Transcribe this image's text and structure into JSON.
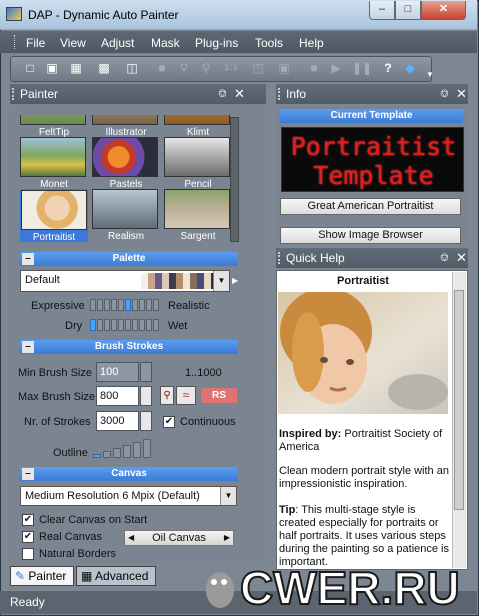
{
  "window": {
    "title": "DAP - Dynamic Auto Painter",
    "min": "–",
    "max": "□",
    "close": "✕"
  },
  "menu": [
    "File",
    "View",
    "Adjust",
    "Mask",
    "Plug-ins",
    "Tools",
    "Help"
  ],
  "toolbar": {
    "zoom_label": "1:1",
    "help_glyph": "?"
  },
  "painter": {
    "title": "Painter",
    "styles_top": [
      "FeltTip",
      "Illustrator",
      "Klimt"
    ],
    "styles_mid": [
      "Monet",
      "Pastels",
      "Pencil"
    ],
    "styles_bot": [
      "Portraitist",
      "Realism",
      "Sargent"
    ],
    "selected": "Portraitist",
    "palette": {
      "header": "Palette",
      "toggle": "–",
      "value": "Default",
      "swatches": [
        "#f4f0e8",
        "#c7a58a",
        "#6a5a8c",
        "#d9cbb6",
        "#3e3a52",
        "#b38e6b",
        "#efe6d2",
        "#8a6d5a",
        "#4b4b7a",
        "#e8d9c2",
        "#2f2a3c",
        "#c9b79d"
      ]
    },
    "expressive_label": "Expressive",
    "realistic_label": "Realistic",
    "expressive_level": 0.55,
    "dry_label": "Dry",
    "wet_label": "Wet",
    "dry_level": 0.0,
    "brush": {
      "header": "Brush Strokes",
      "toggle": "–",
      "min_label": "Min Brush Size",
      "min_value": "100",
      "range": "1..1000",
      "max_label": "Max Brush Size",
      "max_value": "800",
      "rs": "RS",
      "strokes_label": "Nr. of Strokes",
      "strokes_value": "3000",
      "continuous_label": "Continuous",
      "outline_label": "Outline"
    },
    "canvas": {
      "header": "Canvas",
      "toggle": "–",
      "resolution": "Medium Resolution 6 Mpix (Default)",
      "clear_label": "Clear Canvas on Start",
      "real_label": "Real Canvas",
      "canvas_type": "Oil Canvas",
      "borders_label": "Natural Borders"
    },
    "tabs": [
      "Painter",
      "Advanced"
    ]
  },
  "info": {
    "title": "Info",
    "current_template_label": "Current Template",
    "led_line1": "Portraitist",
    "led_line2": "Template",
    "artist_button": "Great American Portraitist",
    "browser_button": "Show Image Browser"
  },
  "help": {
    "title": "Quick Help",
    "heading": "Portraitist",
    "inspired_bold": "Inspired by:",
    "inspired_text": "Portraitist Society of America",
    "desc": "Clean modern portrait style with an impressionistic inspiration.",
    "tip_bold": "Tip",
    "tip_text": ": This multi-stage style is created especially for portraits or half portraits. It uses various steps during the painting so a patience is important."
  },
  "status": "Ready",
  "watermark": "CWER.RU"
}
